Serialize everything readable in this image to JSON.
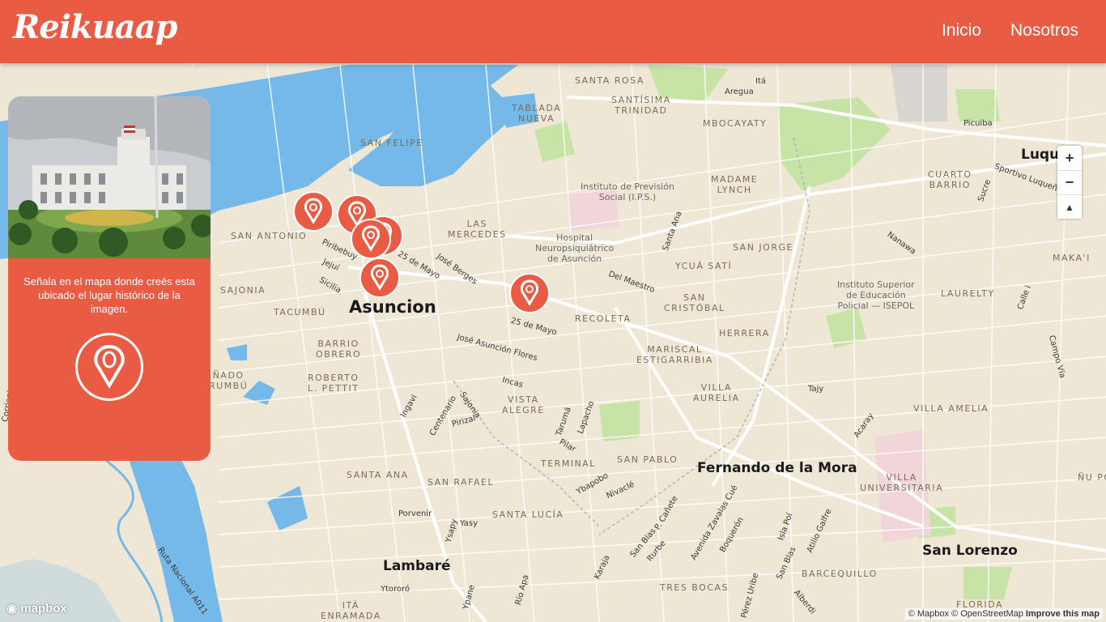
{
  "header": {
    "logo": "Reikuaap",
    "nav": [
      "Inicio",
      "Nosotros"
    ]
  },
  "card": {
    "instruction": "Señala en el mapa donde creés esta ubicado el lugar histórico de la imagen.",
    "pin_icon": "map-pin-icon"
  },
  "map": {
    "cities": [
      "Asuncion",
      "Fernando de la Mora",
      "Lambaré",
      "San Lorenzo",
      "Luque"
    ],
    "districts": [
      "SANTA ROSA",
      "SANTÍSIMA\nTRINIDAD",
      "TABLADA\nNUEVA",
      "MBOCAYATY",
      "SAN FELIPE",
      "SAN ANTONIO",
      "LAS\nMERCEDES",
      "MADAME\nLYNCH",
      "CUARTO\nBARRIO",
      "SAN JORGE",
      "YCUÁ SATÍ",
      "SAJONIA",
      "TACUMBÚ",
      "BARRIO\nOBRERO",
      "ROBERTO\nL. PETTIT",
      "RECOLETA",
      "SAN\nCRISTÓBAL",
      "HERRERA",
      "MARISCAL\nESTIGARRIBIA",
      "VILLA\nAURELIA",
      "VISTA\nALEGRE",
      "LAURELTY",
      "MAKA'I",
      "VILLA AMELIA",
      "SANTA ANA",
      "SAN RAFAEL",
      "TERMINAL",
      "SAN PABLO",
      "SANTA LUCÍA",
      "VILLA\nUNIVERSITARIA",
      "BARCEQUILLO",
      "TRES BOCAS",
      "FLORIDA",
      "ITÁ\nENRAMADA",
      "ÑU PO",
      "ÑADO\nRUMBÚ"
    ],
    "streets": [
      "25 de Mayo",
      "25 de Mayo",
      "José Berges",
      "Piribebuy",
      "Jejuí",
      "Sicilia",
      "Del Maestro",
      "José Asunción Flores",
      "Incas",
      "Ingavi",
      "Centenario",
      "Sajonia",
      "Pirizal",
      "Tarumá",
      "Lapacho",
      "Pilar",
      "Ybapobo",
      "Nivaclé",
      "Santa Ana",
      "Nanawa",
      "Sportivo Luqueño",
      "Sucre",
      "Calle i",
      "Campo Vía",
      "Acaray",
      "Tajy",
      "P. Cañete",
      "Avenida Zavalas Cué",
      "Boquerón",
      "Isla Poí",
      "Atilio Galfre",
      "San Blas",
      "San Blas",
      "Iturbe",
      "Ysapy",
      "Yasy",
      "Porvenir",
      "Río Apa",
      "Ytororó",
      "Ypane",
      "Karaja",
      "Pérez Uribe",
      "Alberdi",
      "Ruta Nacional A011",
      "Aregua",
      "Itá",
      "Picuiba",
      "Corrientes"
    ],
    "pois": [
      "Instituto de Previsión\nSocial (I.P.S.)",
      "Hospital\nNeuropsiquiátrico\nde Asunción",
      "Instituto Superior\nde Educación\nPolicial — ISEPOL"
    ],
    "zoom_in": "+",
    "zoom_out": "−",
    "compass": "▲",
    "attribution_a": "© Mapbox © OpenStreetMap",
    "attribution_b": "Improve this map",
    "brand": "mapbox"
  },
  "colors": {
    "accent": "#ea5b43",
    "water": "#75b9ea",
    "land": "#efe7d6",
    "park": "#bfe3a0"
  }
}
